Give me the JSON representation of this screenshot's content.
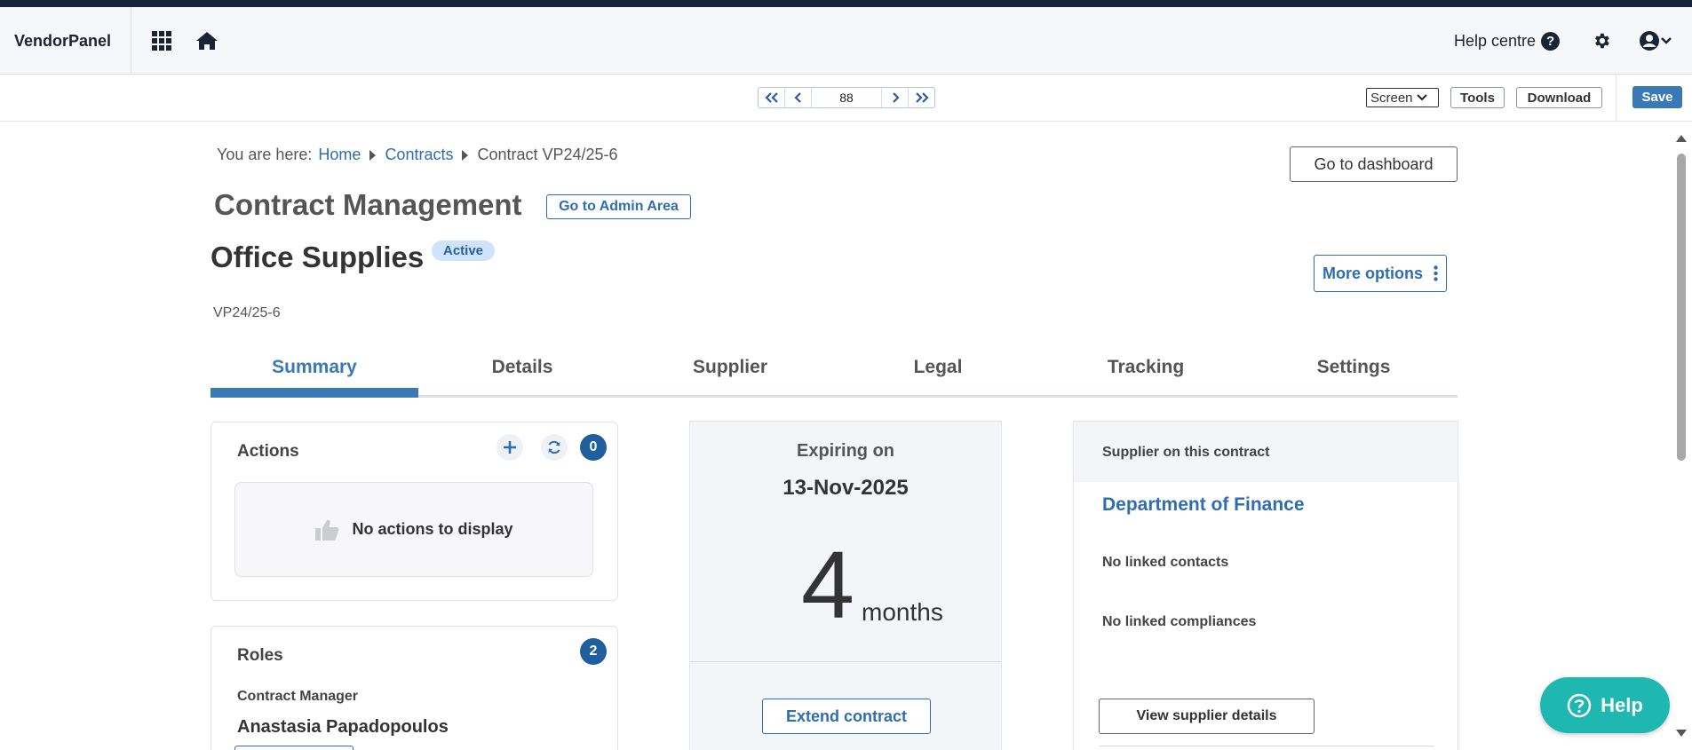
{
  "app": {
    "brand": "VendorPanel",
    "help_centre": "Help centre"
  },
  "toolbar": {
    "page_number": "88",
    "screen_select": "Screen",
    "tools": "Tools",
    "download": "Download",
    "save": "Save"
  },
  "breadcrumb": {
    "prefix": "You are here:",
    "items": [
      "Home",
      "Contracts",
      "Contract VP24/25-6"
    ]
  },
  "header": {
    "go_dashboard": "Go to dashboard",
    "title": "Contract Management",
    "admin_button": "Go to Admin Area",
    "contract_name": "Office Supplies",
    "status": "Active",
    "more_options": "More options",
    "contract_id": "VP24/25-6"
  },
  "tabs": [
    {
      "label": "Summary",
      "active": true
    },
    {
      "label": "Details"
    },
    {
      "label": "Supplier"
    },
    {
      "label": "Legal"
    },
    {
      "label": "Tracking"
    },
    {
      "label": "Settings"
    }
  ],
  "actions": {
    "title": "Actions",
    "count": "0",
    "empty": "No actions to display"
  },
  "roles": {
    "title": "Roles",
    "count": "2",
    "role_label": "Contract Manager",
    "person": "Anastasia Papadopoulos"
  },
  "expiry": {
    "label": "Expiring on",
    "date": "13-Nov-2025",
    "number": "4",
    "unit": "months",
    "extend_button": "Extend contract"
  },
  "supplier": {
    "header": "Supplier on this contract",
    "name": "Department of Finance",
    "contacts": "No linked contacts",
    "compliances": "No linked compliances",
    "view_button": "View supplier details"
  },
  "help_fab": "Help",
  "colors": {
    "accent": "#3b79b6",
    "link": "#2f6db1",
    "badge": "#1f5f9e",
    "help": "#1fb8b0",
    "topbar": "#15223b"
  },
  "icons": [
    "apps-grid-icon",
    "home-icon",
    "help-circle-icon",
    "gear-icon",
    "user-account-icon",
    "chevron-down-icon",
    "double-chevron-left-icon",
    "chevron-left-icon",
    "chevron-right-icon",
    "double-chevron-right-icon",
    "plus-icon",
    "refresh-icon",
    "thumbs-up-icon",
    "kebab-icon"
  ]
}
